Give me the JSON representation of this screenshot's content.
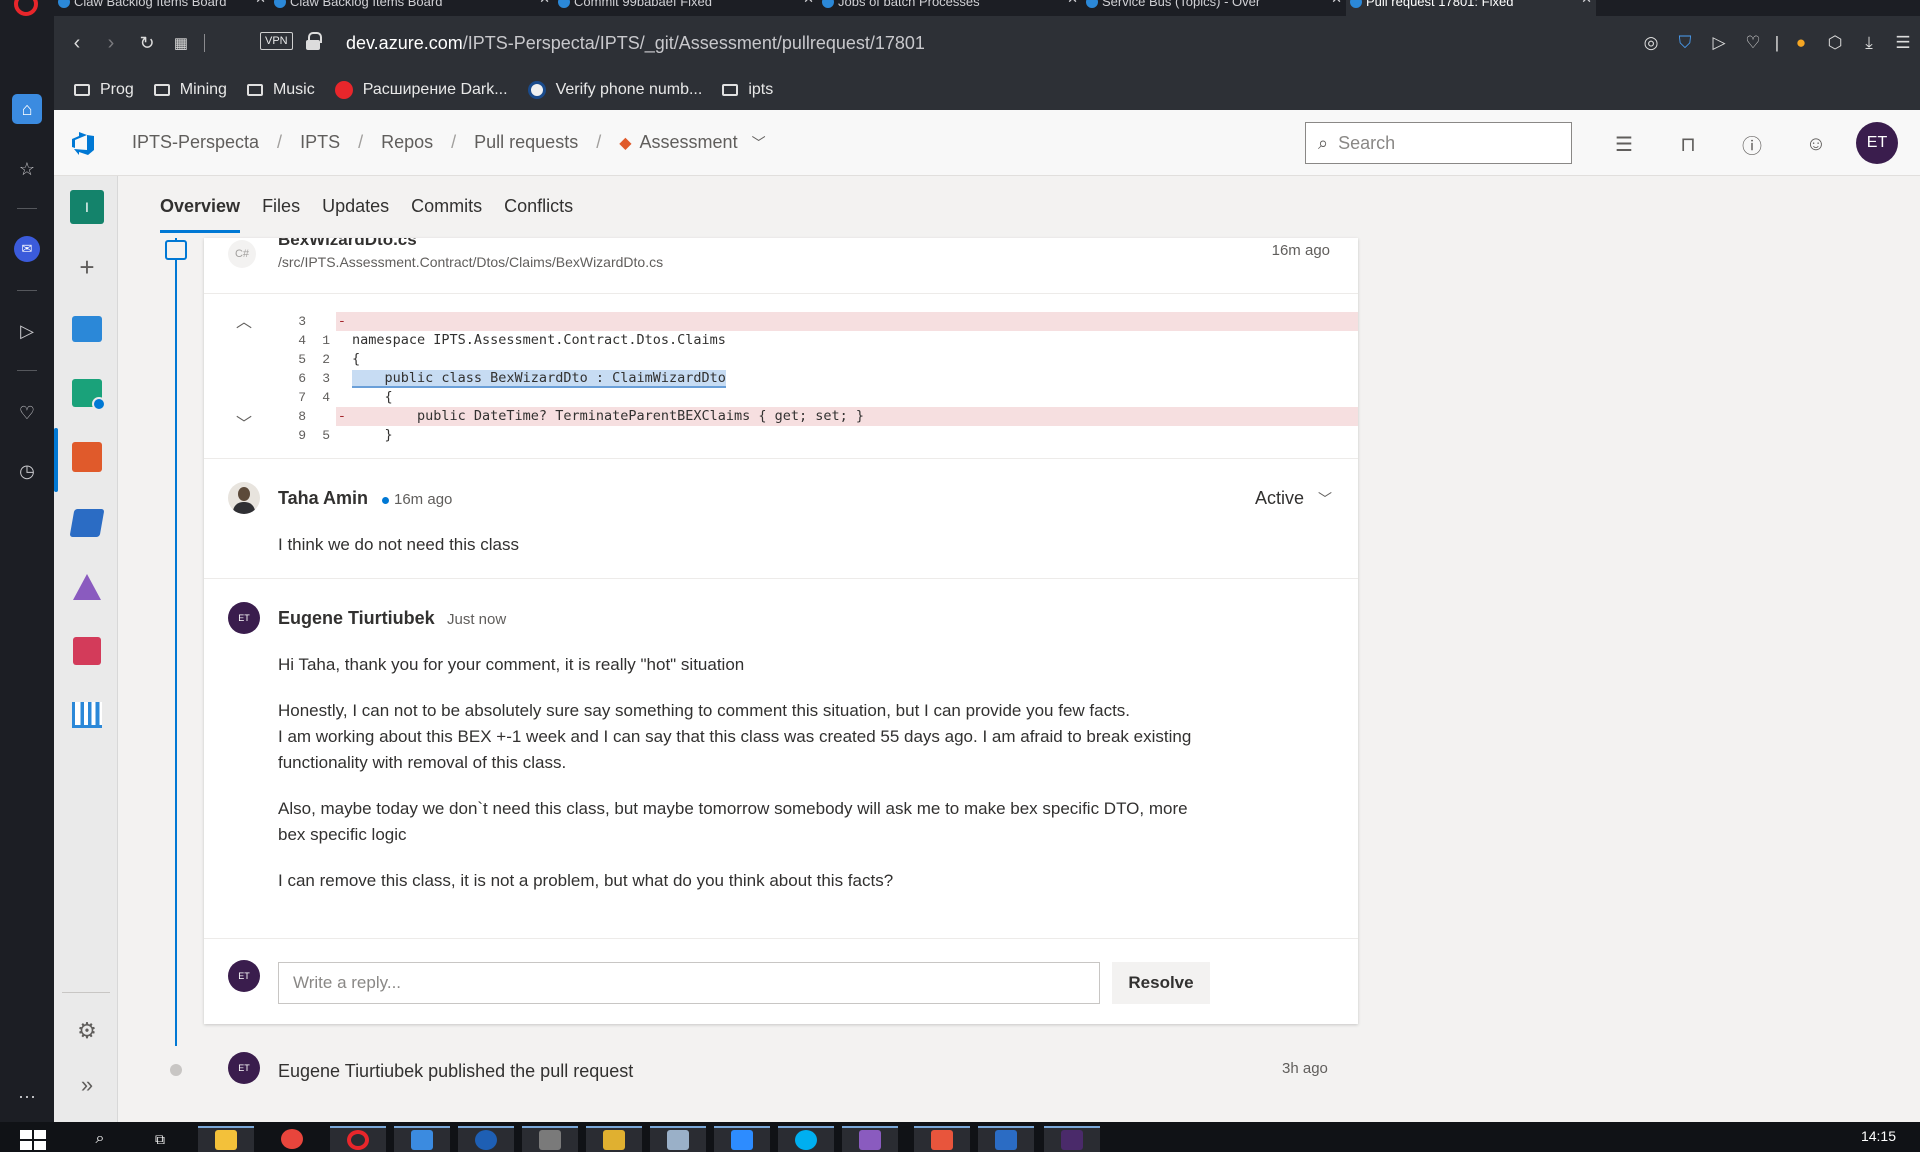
{
  "browser": {
    "tabs": [
      {
        "label": "Claw Backlog Items Board"
      },
      {
        "label": "Claw Backlog Items Board"
      },
      {
        "label": "Commit 99babaef Fixed"
      },
      {
        "label": "Jobs of batch Processes"
      },
      {
        "label": "Service Bus (Topics) - Over"
      },
      {
        "label": "Pull request 17801: Fixed"
      }
    ],
    "vpn_label": "VPN",
    "url_domain": "dev.azure.com",
    "url_path": "/IPTS-Perspecta/IPTS/_git/Assessment/pullrequest/17801",
    "bookmarks": [
      {
        "label": "Prog",
        "type": "folder"
      },
      {
        "label": "Mining",
        "type": "folder"
      },
      {
        "label": "Music",
        "type": "folder"
      },
      {
        "label": "Расширение Dark...",
        "type": "link",
        "color": "#e8262b"
      },
      {
        "label": "Verify phone numb...",
        "type": "link",
        "color": "#1a4b8c"
      },
      {
        "label": "ipts",
        "type": "folder"
      }
    ]
  },
  "header": {
    "breadcrumbs": [
      "IPTS-Perspecta",
      "IPTS",
      "Repos",
      "Pull requests",
      "Assessment"
    ],
    "search_placeholder": "Search",
    "avatar_initials": "ET"
  },
  "pr_tabs": [
    "Overview",
    "Files",
    "Updates",
    "Commits",
    "Conflicts"
  ],
  "thread": {
    "file_icon": "C#",
    "file_name": "BexWizardDto.cs",
    "file_path": "/src/IPTS.Assessment.Contract/Dtos/Claims/BexWizardDto.cs",
    "file_time": "16m ago",
    "diff": [
      {
        "old": "3",
        "new": "",
        "code": "",
        "type": "del"
      },
      {
        "old": "4",
        "new": "1",
        "code": "namespace IPTS.Assessment.Contract.Dtos.Claims",
        "type": "ctx"
      },
      {
        "old": "5",
        "new": "2",
        "code": "{",
        "type": "ctx"
      },
      {
        "old": "6",
        "new": "3",
        "code": "    public class BexWizardDto : ClaimWizardDto",
        "type": "hl"
      },
      {
        "old": "7",
        "new": "4",
        "code": "    {",
        "type": "ctx"
      },
      {
        "old": "8",
        "new": "",
        "code": "        public DateTime? TerminateParentBEXClaims { get; set; }",
        "type": "del"
      },
      {
        "old": "9",
        "new": "5",
        "code": "    }",
        "type": "ctx"
      }
    ],
    "comments": [
      {
        "author": "Taha Amin",
        "time": "16m ago",
        "status": "Active",
        "paragraphs": [
          "I think we do not need this class"
        ]
      },
      {
        "author": "Eugene Tiurtiubek",
        "time": "Just now",
        "avatar_initials": "ET",
        "paragraphs": [
          "Hi Taha, thank you for your comment, it is really \"hot\" situation",
          "Honestly, I can not to be absolutely sure say something to comment this situation, but I can provide you few facts.\nI am working about this BEX +-1 week and I can say that this class was created 55 days ago. I am afraid to break existing functionality with removal of this class.",
          "Also, maybe today we don`t need this class, but maybe tomorrow somebody will ask me to make bex specific DTO, more bex specific logic",
          "I can remove this class, it is not a problem, but what do you think about this facts?"
        ]
      }
    ],
    "reply_placeholder": "Write a reply...",
    "resolve_label": "Resolve",
    "reply_avatar_initials": "ET"
  },
  "event": {
    "avatar_initials": "ET",
    "text": "Eugene Tiurtiubek published the pull request",
    "time": "3h ago"
  },
  "taskbar": {
    "clock": "14:15"
  },
  "colors": {
    "accent": "#0078d4",
    "avatar": "#3a1d4d",
    "deleted_line": "#f6dfe0",
    "highlight": "#c7dcf3"
  }
}
